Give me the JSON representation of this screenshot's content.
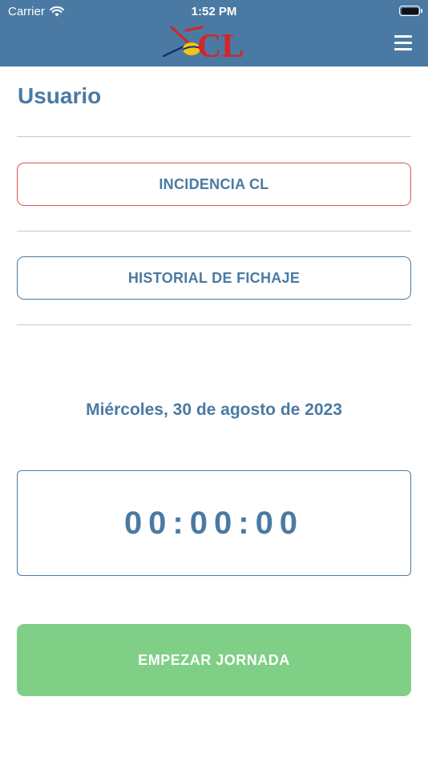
{
  "status_bar": {
    "carrier": "Carrier",
    "time": "1:52 PM"
  },
  "header": {
    "logo_text": "CL",
    "bar_color": "#4a7aa3"
  },
  "page": {
    "title": "Usuario"
  },
  "buttons": {
    "incidencia": "INCIDENCIA CL",
    "historial": "HISTORIAL DE FICHAJE",
    "start": "EMPEZAR JORNADA"
  },
  "date": "Miércoles, 30 de agosto de 2023",
  "timer": "00:00:00",
  "colors": {
    "primary": "#4a7aa3",
    "incidencia_border": "#e05252",
    "start_button": "#7fcf86"
  }
}
